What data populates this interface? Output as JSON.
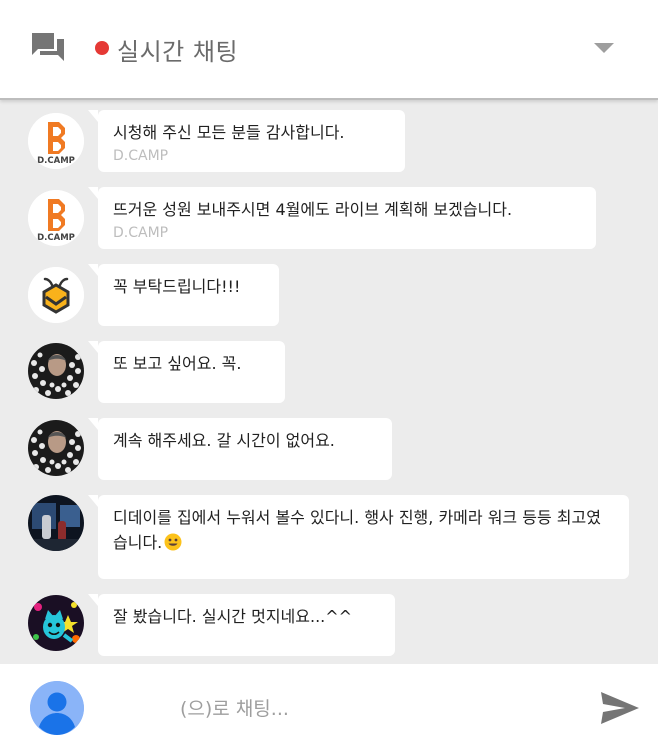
{
  "header": {
    "title": "실시간 채팅",
    "live_color": "#e53935",
    "chat_icon": "chat-bubbles-icon",
    "menu_icon": "chevron-down-icon"
  },
  "messages": [
    {
      "author": "D.CAMP",
      "avatar": "dcamp-logo",
      "avatar_label": "D.CAMP",
      "text": "시청해 주신 모든 분들 감사합니다."
    },
    {
      "author": "D.CAMP",
      "avatar": "dcamp-logo",
      "avatar_label": "D.CAMP",
      "text": "뜨거운 성원 보내주시면 4월에도 라이브 계획해 보겠습니다."
    },
    {
      "author": "",
      "avatar": "bee-avatar",
      "text": "꼭 부탁드립니다!!!"
    },
    {
      "author": "",
      "avatar": "dotted-portrait-avatar",
      "text": "또 보고 싶어요. 꼭."
    },
    {
      "author": "",
      "avatar": "dotted-portrait-avatar",
      "text": "계속 해주세요. 갈 시간이 없어요."
    },
    {
      "author": "",
      "avatar": "photo-avatar",
      "text": "디데이를 집에서 누워서 볼수 있다니. 행사 진행, 카메라 워크 등등 최고였습니다.",
      "emoji": "smiley-emoji"
    },
    {
      "author": "",
      "avatar": "cartoon-cat-avatar",
      "text": "잘 봤습니다. 실시간 멋지네요...^^"
    }
  ],
  "composer": {
    "placeholder": "(으)로 채팅...",
    "value": "",
    "send_icon": "send-icon",
    "avatar": "default-user-avatar"
  }
}
